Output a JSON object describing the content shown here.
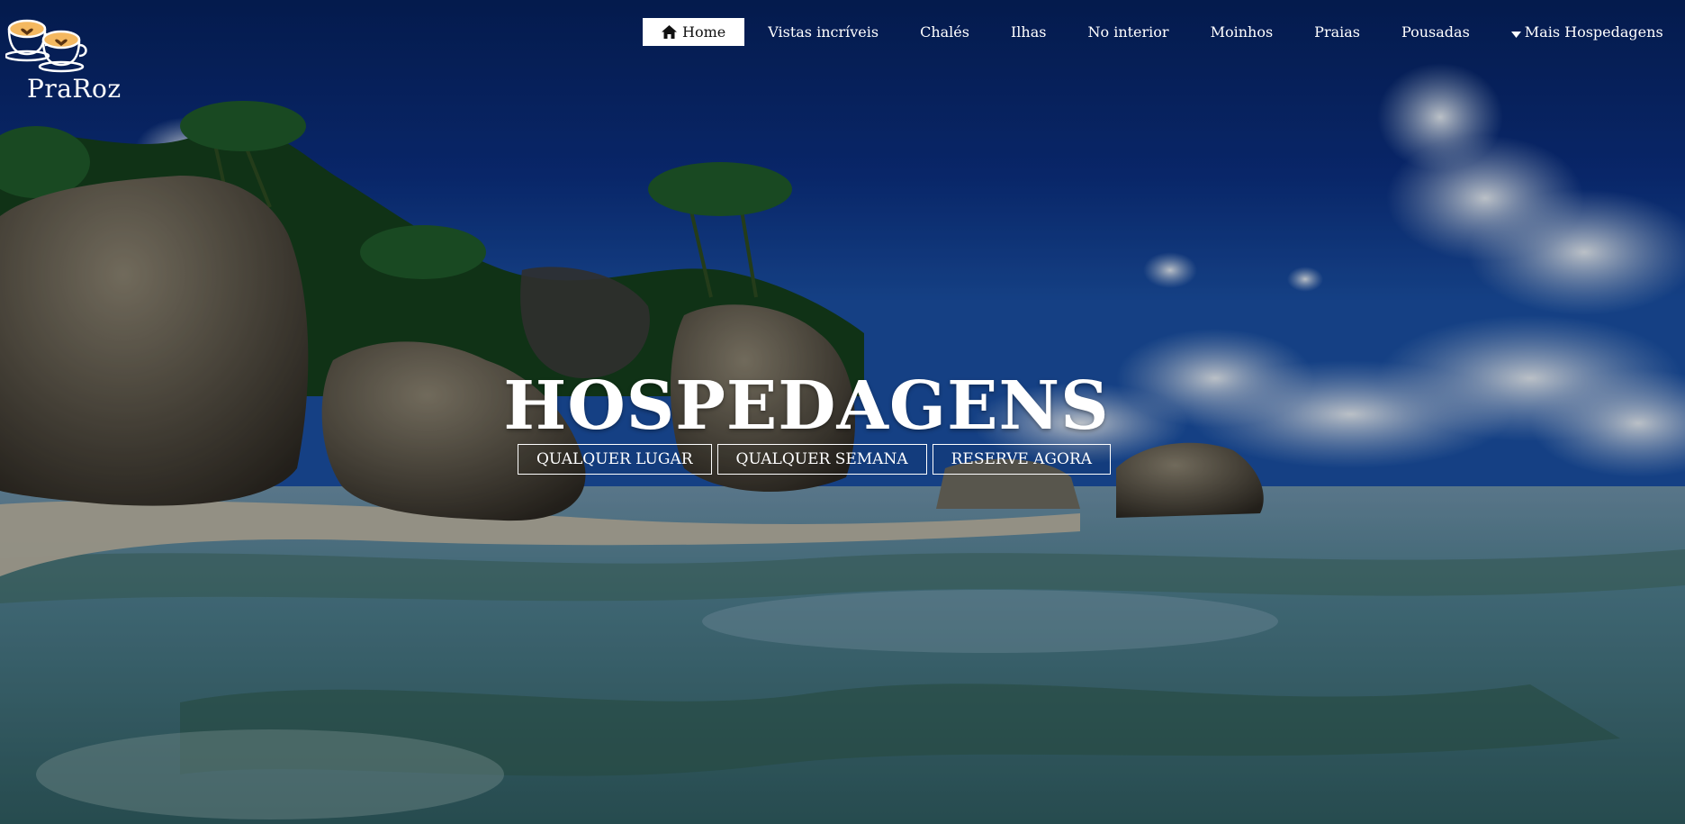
{
  "brand": {
    "name": "PraRoz",
    "logo_icon": "two-coffee-cups-with-hearts-logo"
  },
  "nav": {
    "home_icon": "home-icon",
    "more_icon": "caret-down-icon",
    "items": [
      {
        "label": "Home",
        "active": true
      },
      {
        "label": "Vistas incríveis"
      },
      {
        "label": "Chalés"
      },
      {
        "label": "Ilhas"
      },
      {
        "label": "No interior"
      },
      {
        "label": "Moinhos"
      },
      {
        "label": "Praias"
      },
      {
        "label": "Pousadas"
      },
      {
        "label": "Mais Hospedagens"
      }
    ]
  },
  "hero": {
    "title": "HOSPEDAGENS",
    "buttons": [
      {
        "label": "QUALQUER LUGAR"
      },
      {
        "label": "QUALQUER SEMANA"
      },
      {
        "label": "RESERVE AGORA"
      }
    ],
    "background": "tropical-beach-granite-boulders-photo"
  },
  "colors": {
    "sky": "#0b2f80",
    "nav_active_bg": "#ffffff",
    "text": "#ffffff"
  }
}
